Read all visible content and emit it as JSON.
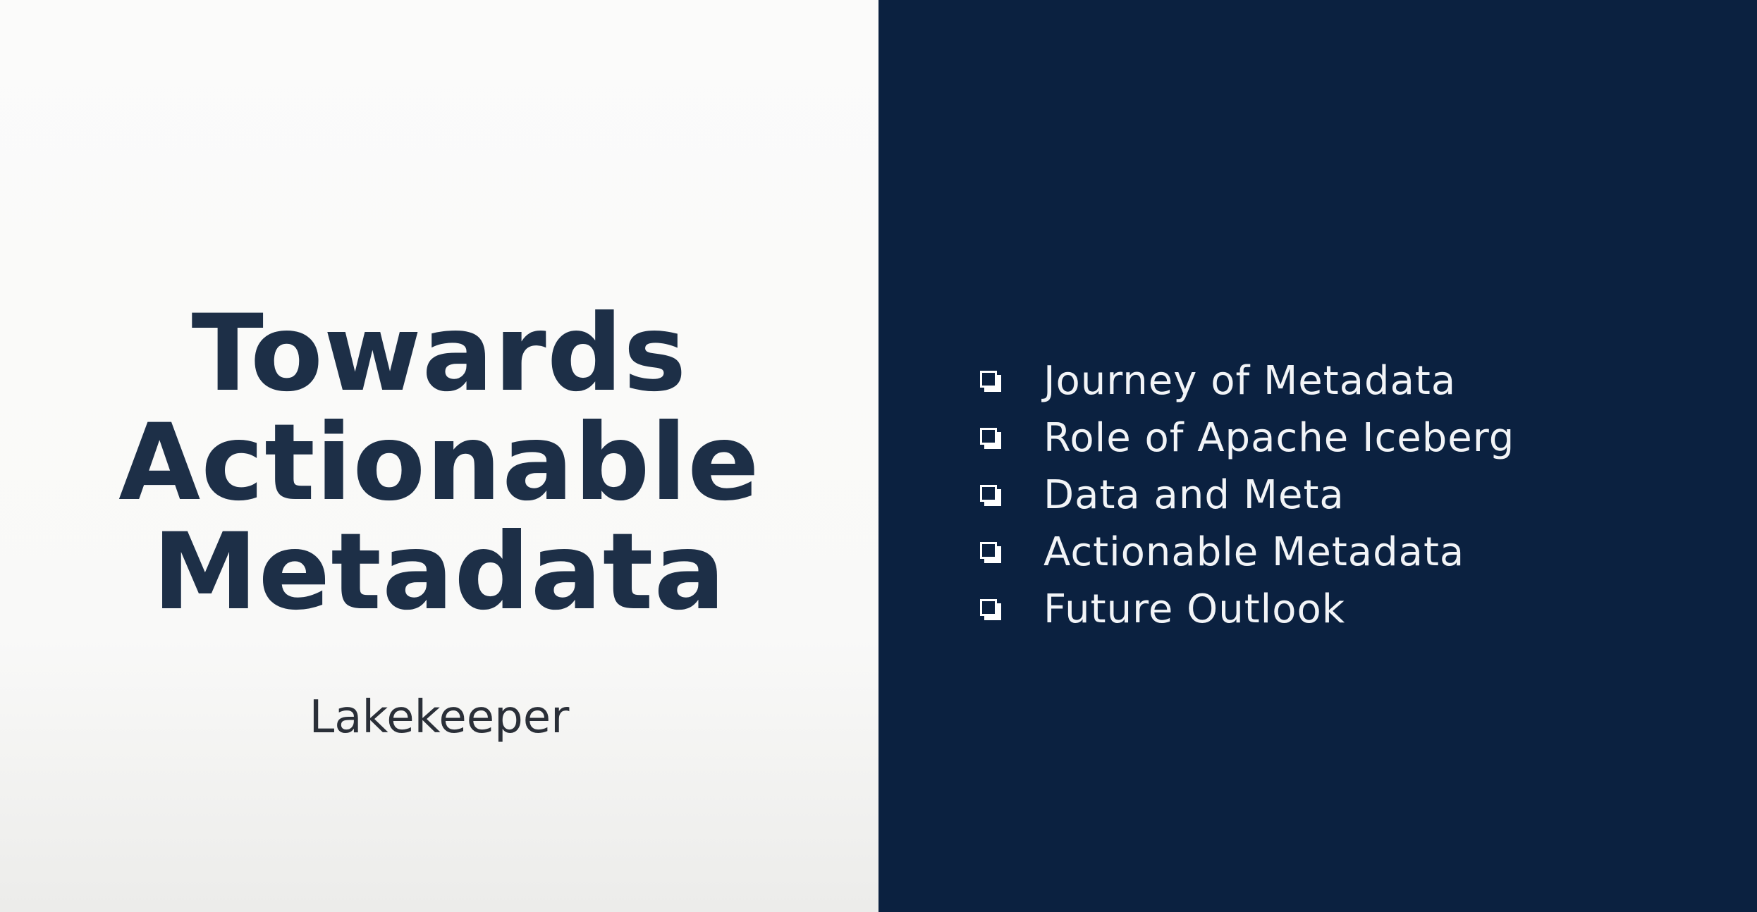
{
  "slide": {
    "title_lines": [
      "Towards",
      "Actionable",
      "Metadata"
    ],
    "subtitle": "Lakekeeper",
    "agenda": [
      {
        "label": "Journey of Metadata",
        "icon": "checkbox-icon"
      },
      {
        "label": "Role of Apache Iceberg",
        "icon": "checkbox-icon"
      },
      {
        "label": "Data and Meta",
        "icon": "checkbox-icon"
      },
      {
        "label": "Actionable Metadata",
        "icon": "checkbox-icon"
      },
      {
        "label": "Future Outlook",
        "icon": "checkbox-icon"
      }
    ]
  },
  "colors": {
    "left_background": "#fbfbfa",
    "right_background": "#0b2140",
    "title_text": "#1d2f47",
    "subtitle_text": "#2a2f38",
    "agenda_text": "#f2f4f7"
  }
}
